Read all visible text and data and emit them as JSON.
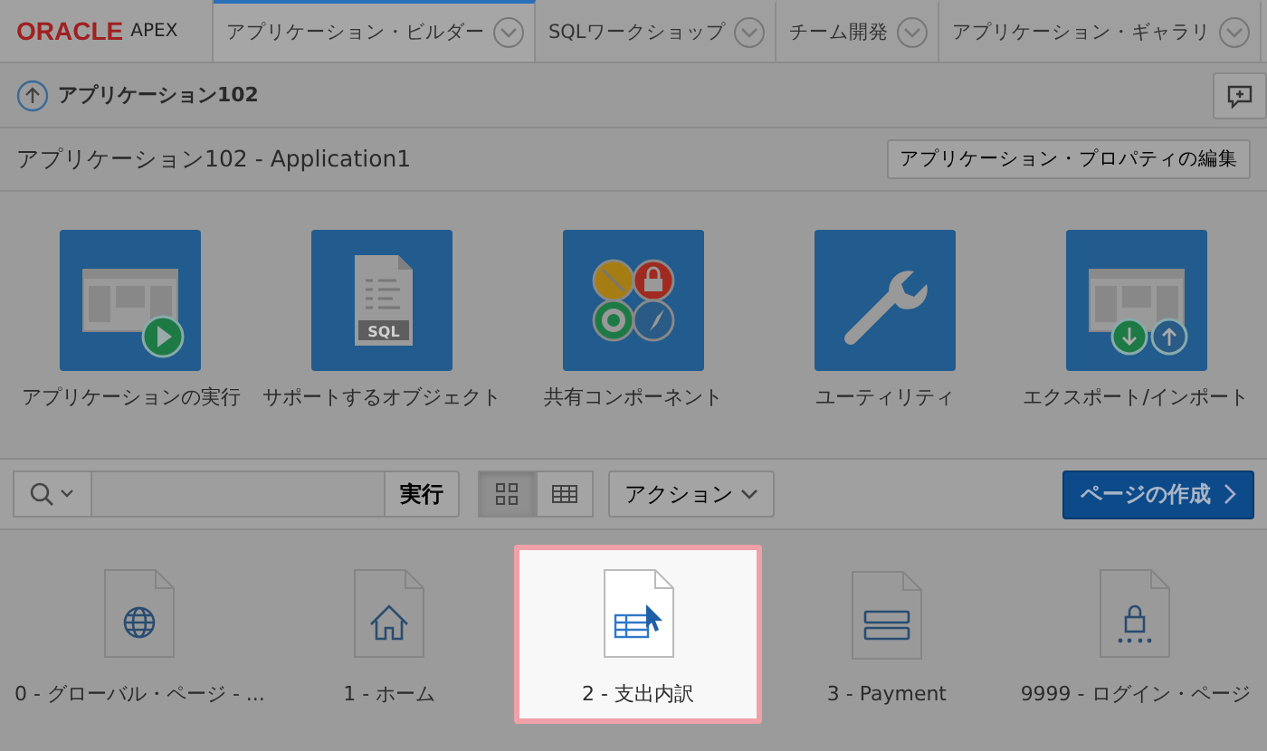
{
  "header": {
    "logo": "ORACLE",
    "product": "APEX",
    "tabs": [
      {
        "label": "アプリケーション・ビルダー",
        "selected": true
      },
      {
        "label": "SQLワークショップ",
        "selected": false
      },
      {
        "label": "チーム開発",
        "selected": false
      },
      {
        "label": "アプリケーション・ギャラリ",
        "selected": false
      }
    ]
  },
  "breadcrumb": "アプリケーション102",
  "title": "アプリケーション102 - Application1",
  "edit_button": "アプリケーション・プロパティの編集",
  "tiles": [
    {
      "label": "アプリケーションの実行",
      "kind": "run"
    },
    {
      "label": "サポートするオブジェクト",
      "kind": "sql",
      "badge": "SQL"
    },
    {
      "label": "共有コンポーネント",
      "kind": "shared"
    },
    {
      "label": "ユーティリティ",
      "kind": "utility"
    },
    {
      "label": "エクスポート/インポート",
      "kind": "export"
    }
  ],
  "toolbar": {
    "go_button": "実行",
    "views": [
      {
        "kind": "icons",
        "selected": true
      },
      {
        "kind": "report",
        "selected": false
      }
    ],
    "actions": "アクション",
    "create_button": "ページの作成"
  },
  "pages": [
    {
      "label": "0 - グローバル・ページ - ...",
      "kind": "globe",
      "selected": false
    },
    {
      "label": "1 - ホーム",
      "kind": "home",
      "selected": false
    },
    {
      "label": "2 - 支出内訳",
      "kind": "grid",
      "selected": true
    },
    {
      "label": "3 - Payment",
      "kind": "form",
      "selected": false
    },
    {
      "label": "9999 - ログイン・ページ",
      "kind": "login",
      "selected": false
    }
  ]
}
